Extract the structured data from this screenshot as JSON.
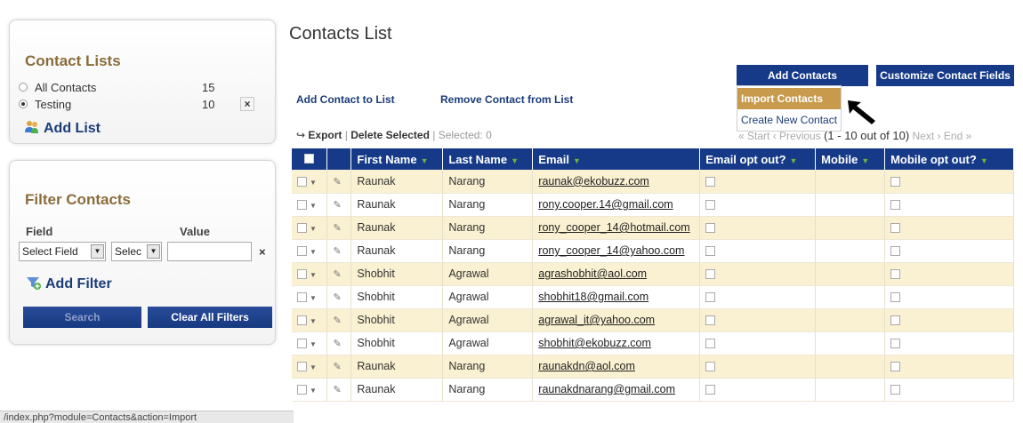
{
  "sidebar": {
    "contact_lists_title": "Contact Lists",
    "lists": [
      {
        "name": "All Contacts",
        "count": "15",
        "selected": false
      },
      {
        "name": "Testing",
        "count": "10",
        "selected": true
      }
    ],
    "delete_glyph": "×",
    "add_list_label": "Add List",
    "filter_title": "Filter Contacts",
    "field_header": "Field",
    "value_header": "Value",
    "select_field": "Select Field",
    "select_op": "Selec",
    "filter_remove": "×",
    "add_filter_label": "Add Filter",
    "search_label": "Search",
    "clear_label": "Clear All Filters"
  },
  "main": {
    "title": "Contacts List",
    "add_to_list": "Add Contact to List",
    "remove_from_list": "Remove Contact from List",
    "add_contacts": "Add Contacts",
    "customize_fields": "Customize Contact Fields",
    "dropdown": [
      "Import Contacts",
      "Create New Contact"
    ],
    "export": "Export",
    "delete_selected": "Delete Selected",
    "selected_label": "Selected:  0",
    "pager_start": "« Start",
    "pager_prev": "‹ Previous",
    "pager_count": "(1 - 10 out of 10)",
    "pager_next": "Next ›",
    "pager_end": "End »"
  },
  "table": {
    "headers": [
      "First Name",
      "Last Name",
      "Email",
      "Email opt out?",
      "Mobile",
      "Mobile opt out?"
    ],
    "rows": [
      [
        "Raunak",
        "Narang",
        "raunak@ekobuzz.com"
      ],
      [
        "Raunak",
        "Narang",
        "rony.cooper.14@gmail.com"
      ],
      [
        "Raunak",
        "Narang",
        "rony_cooper_14@hotmail.com"
      ],
      [
        "Raunak",
        "Narang",
        "rony_cooper_14@yahoo.com"
      ],
      [
        "Shobhit",
        "Agrawal",
        "agrashobhit@aol.com"
      ],
      [
        "Shobhit",
        "Agrawal",
        "shobhit18@gmail.com"
      ],
      [
        "Shobhit",
        "Agrawal",
        "agrawal_it@yahoo.com"
      ],
      [
        "Shobhit",
        "Agrawal",
        "shobhit@ekobuzz.com"
      ],
      [
        "Raunak",
        "Narang",
        "raunakdn@aol.com"
      ],
      [
        "Raunak",
        "Narang",
        "raunakdnarang@gmail.com"
      ]
    ]
  },
  "status_url": "/index.php?module=Contacts&action=Import",
  "colors": {
    "nav_blue": "#163a88",
    "gold": "#c79a4c",
    "row_odd": "#faf1d2",
    "title_brown": "#8a6d3b"
  }
}
